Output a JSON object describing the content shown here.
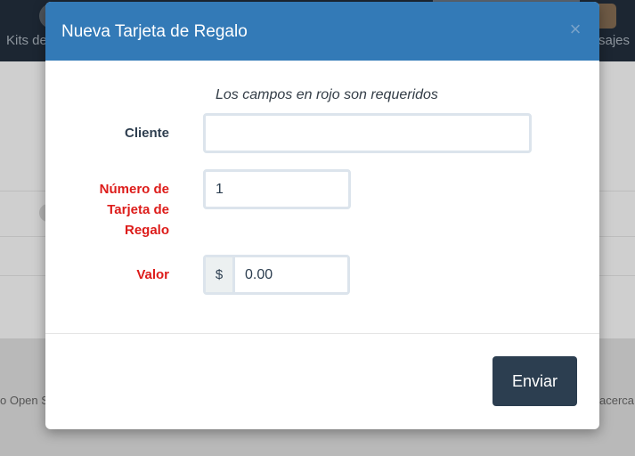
{
  "background": {
    "nav_left_text": "Kits de",
    "nav_right_text": "sajes",
    "footer_left_text": "o Open S",
    "footer_right_text": "acerca"
  },
  "modal": {
    "title": "Nueva Tarjeta de Regalo",
    "close_icon": "×",
    "required_note": "Los campos en rojo son requeridos"
  },
  "form": {
    "client_label": "Cliente",
    "client_value": "",
    "number_label": "Número de Tarjeta de Regalo",
    "number_value": "1",
    "value_label": "Valor",
    "currency_symbol": "$",
    "value_amount": "0.00"
  },
  "footer": {
    "submit_label": "Enviar"
  },
  "colors": {
    "header": "#337ab7",
    "required_text": "#dd1c1a",
    "submit_button": "#2c3e50"
  }
}
